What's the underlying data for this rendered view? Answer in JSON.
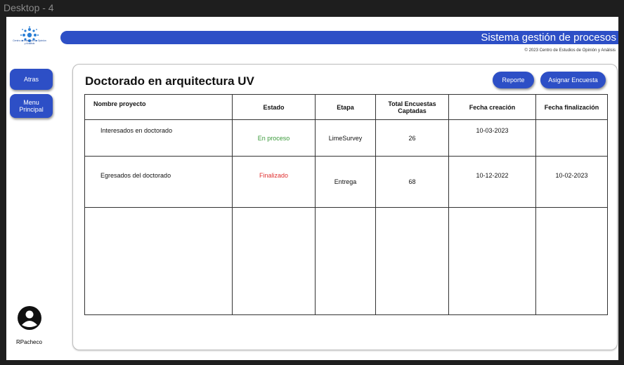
{
  "window": {
    "frame_label": "Desktop - 4"
  },
  "brand": {
    "logo_text": "Centro de Estudios de Opinión y Análisis",
    "accent_color": "#2d4fc6"
  },
  "header": {
    "system_title": "Sistema gestión de procesos",
    "copyright": "© 2023 Centro de Estudios de Opinión y Análisis"
  },
  "sidebar": {
    "back_label": "Atras",
    "menu_label_line1": "Menu",
    "menu_label_line2": "Principal",
    "username": "RPacheco"
  },
  "main": {
    "title": "Doctorado en arquitectura UV",
    "report_label": "Reporte",
    "assign_label": "Asignar Encuesta"
  },
  "table": {
    "headers": {
      "name": "Nombre proyecto",
      "status": "Estado",
      "stage": "Etapa",
      "total_line1": "Total Encuestas",
      "total_line2": "Captadas",
      "created": "Fecha creación",
      "finished": "Fecha finalización"
    },
    "rows": [
      {
        "name": "Interesados en doctorado",
        "status": "En proceso",
        "stage": "LimeSurvey",
        "total": "26",
        "created": "10-03-2023",
        "finished": ""
      },
      {
        "name": "Egresados del doctorado",
        "status": "Finalizado",
        "stage": "Entrega",
        "total": "68",
        "created": "10-12-2022",
        "finished": "10-02-2023"
      }
    ]
  },
  "status_colors": {
    "in_progress": "#3a9a3a",
    "finished": "#e03030"
  }
}
